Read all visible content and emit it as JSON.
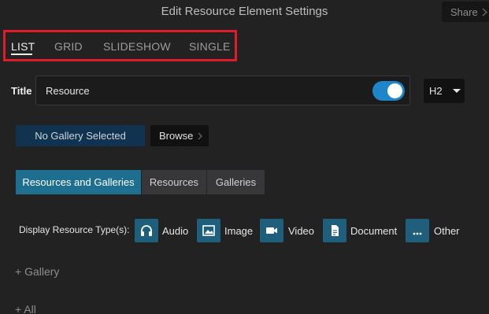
{
  "header": {
    "title": "Edit Resource Element Settings",
    "share_label": "Share"
  },
  "layout_tabs": {
    "items": [
      {
        "label": "LIST",
        "active": true
      },
      {
        "label": "GRID",
        "active": false
      },
      {
        "label": "SLIDESHOW",
        "active": false
      },
      {
        "label": "SINGLE",
        "active": false
      }
    ]
  },
  "title_field": {
    "label": "Title",
    "value": "Resource",
    "toggle_on": true,
    "heading_level": "H2"
  },
  "gallery": {
    "status": "No Gallery Selected",
    "browse_label": "Browse"
  },
  "content_filter": {
    "options": [
      {
        "label": "Resources and Galleries",
        "active": true
      },
      {
        "label": "Resources",
        "active": false
      },
      {
        "label": "Galleries",
        "active": false
      }
    ]
  },
  "resource_types": {
    "label": "Display Resource Type(s):",
    "items": [
      {
        "label": "Audio",
        "icon": "headphones-icon"
      },
      {
        "label": "Image",
        "icon": "image-icon"
      },
      {
        "label": "Video",
        "icon": "video-camera-icon"
      },
      {
        "label": "Document",
        "icon": "document-icon"
      },
      {
        "label": "Other",
        "icon": "ellipsis-icon"
      }
    ]
  },
  "expanders": {
    "gallery": "+ Gallery",
    "all": "+ All"
  },
  "colors": {
    "background": "#222223",
    "accent": "#1e6f8f",
    "toggle": "#1e86c8",
    "highlight_border": "#e11b2a",
    "gallery_status_bg": "#113350"
  }
}
